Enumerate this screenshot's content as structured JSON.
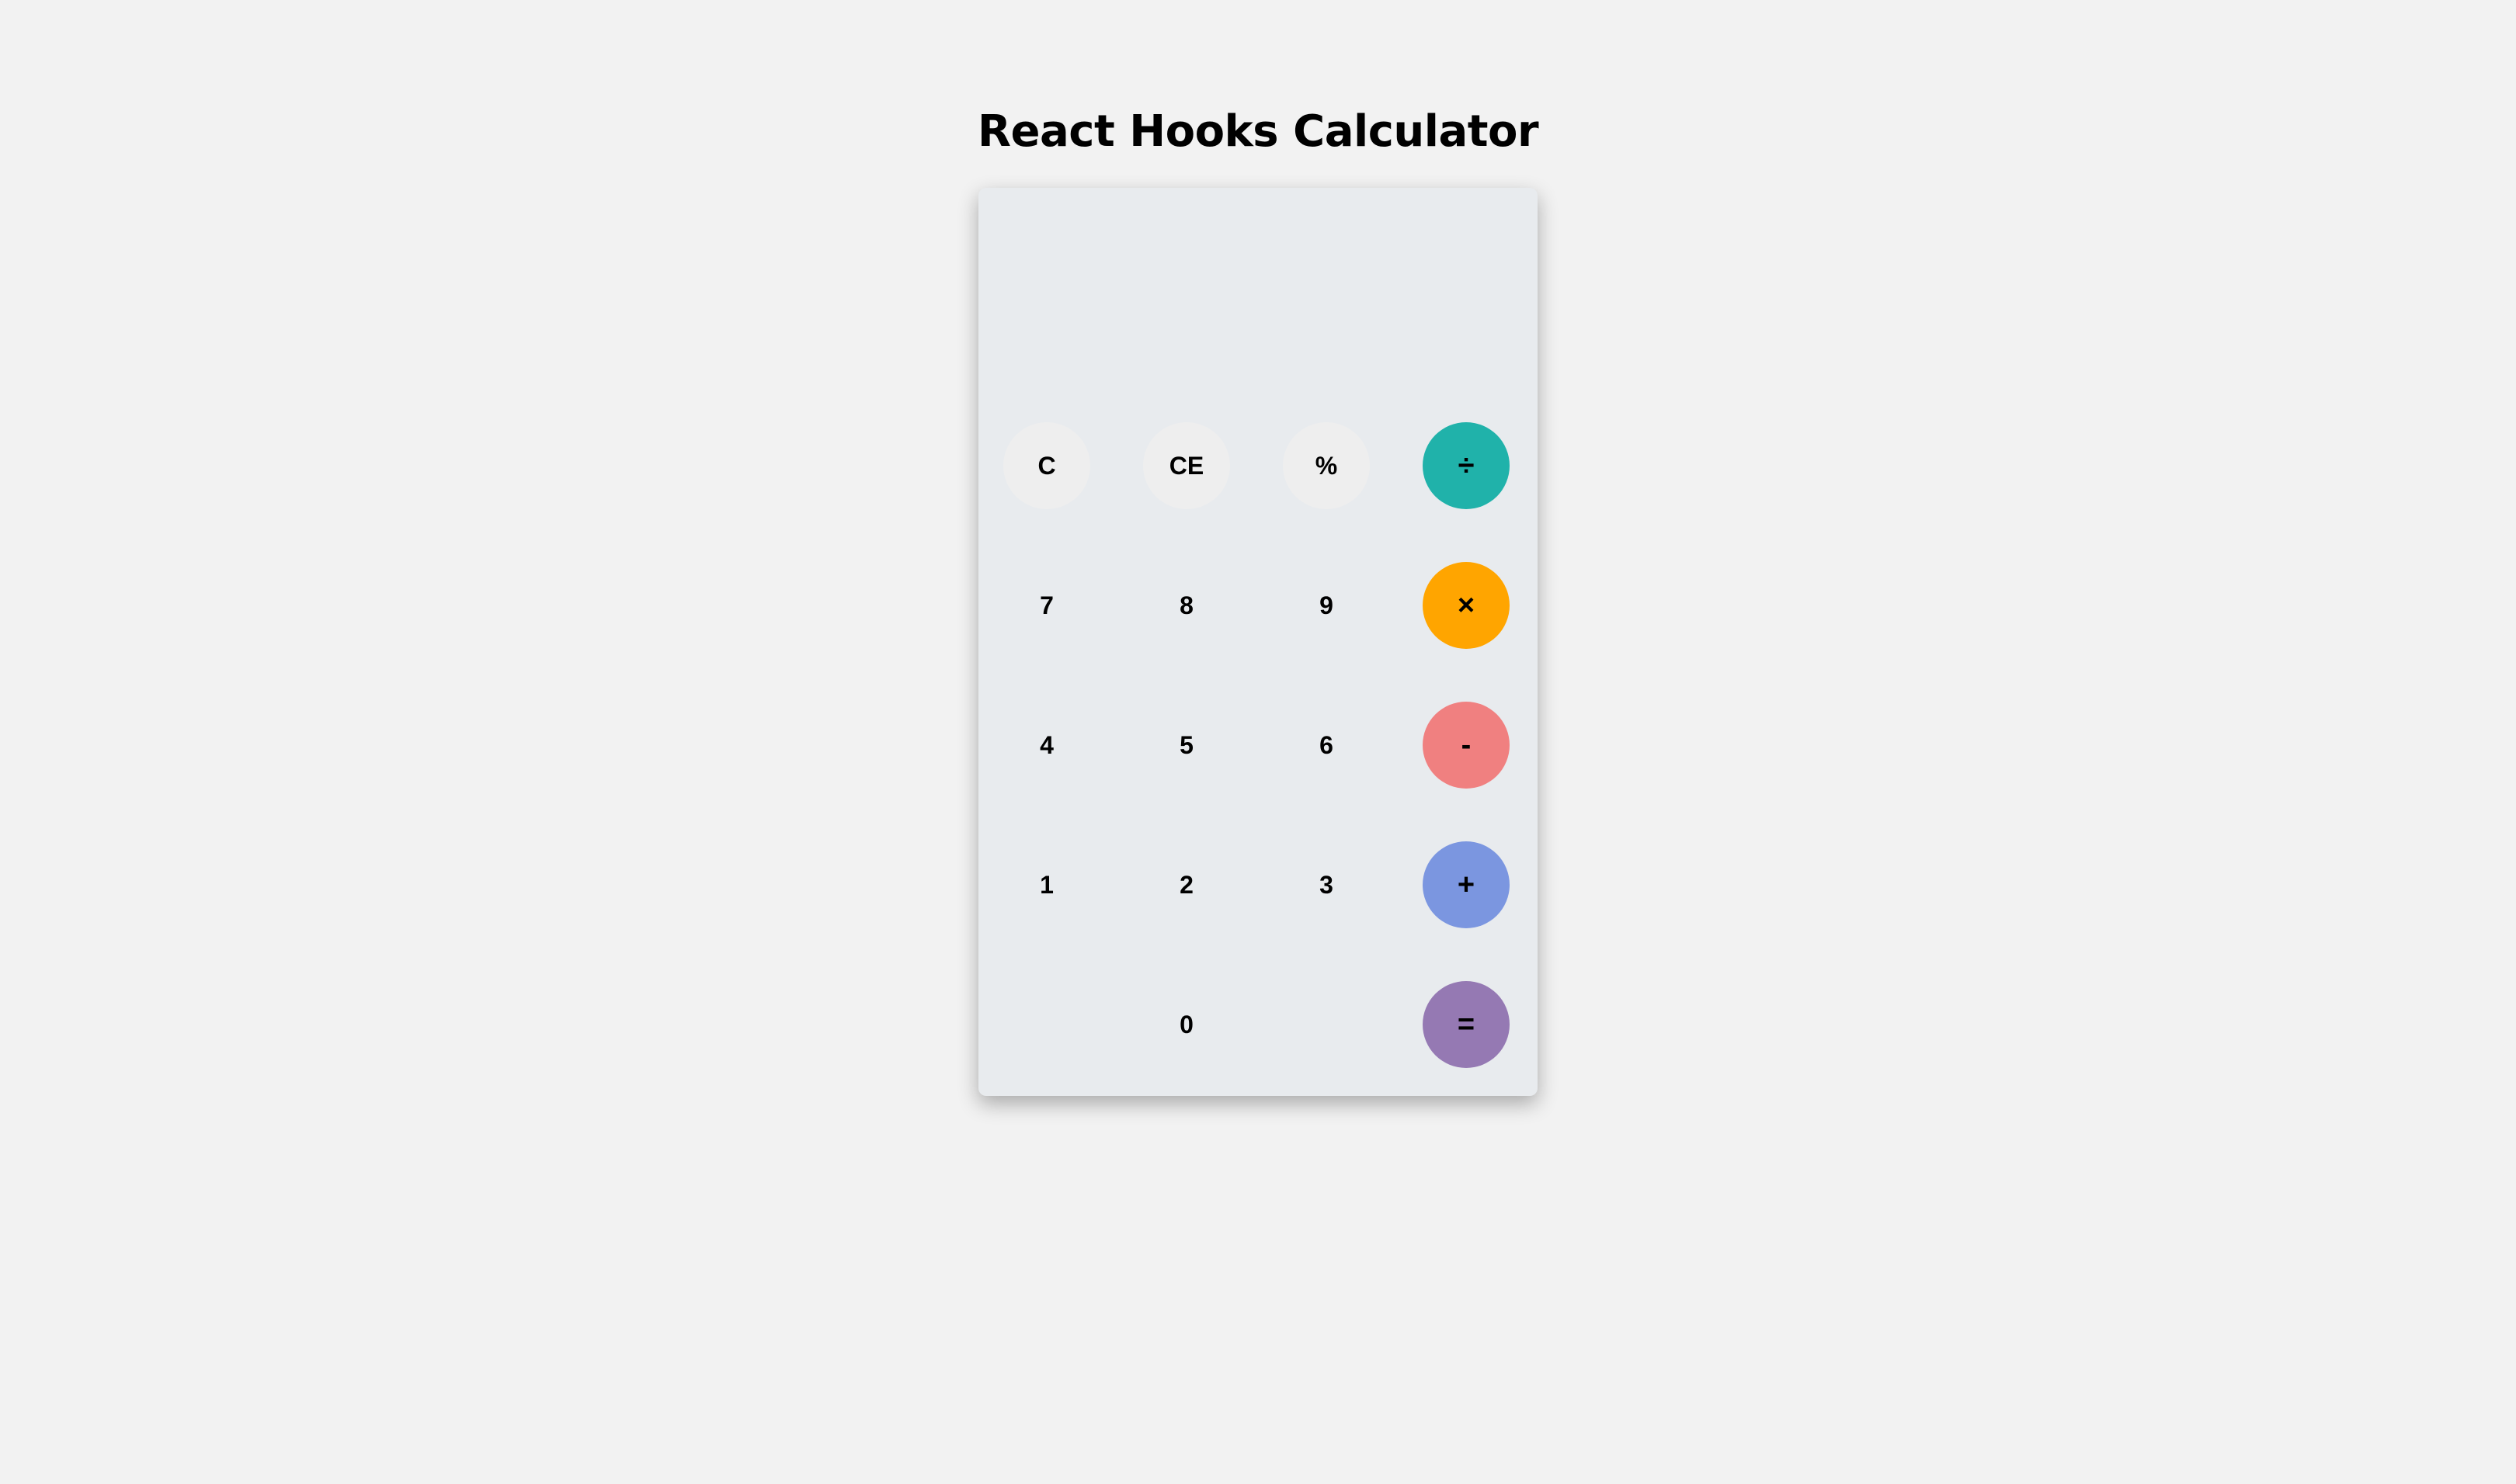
{
  "title": "React Hooks Calculator",
  "display": {
    "value": ""
  },
  "keys": [
    {
      "label": "C",
      "kind": "fn",
      "name": "clear-button"
    },
    {
      "label": "CE",
      "kind": "fn",
      "name": "clear-entry-button"
    },
    {
      "label": "%",
      "kind": "fn",
      "name": "percent-button"
    },
    {
      "label": "÷",
      "kind": "op",
      "name": "divide-button",
      "color": "#20b2aa"
    },
    {
      "label": "7",
      "kind": "num",
      "name": "digit-7-button"
    },
    {
      "label": "8",
      "kind": "num",
      "name": "digit-8-button"
    },
    {
      "label": "9",
      "kind": "num",
      "name": "digit-9-button"
    },
    {
      "label": "×",
      "kind": "op",
      "name": "multiply-button",
      "color": "#ffa500"
    },
    {
      "label": "4",
      "kind": "num",
      "name": "digit-4-button"
    },
    {
      "label": "5",
      "kind": "num",
      "name": "digit-5-button"
    },
    {
      "label": "6",
      "kind": "num",
      "name": "digit-6-button"
    },
    {
      "label": "-",
      "kind": "op",
      "name": "subtract-button",
      "color": "#f08080"
    },
    {
      "label": "1",
      "kind": "num",
      "name": "digit-1-button"
    },
    {
      "label": "2",
      "kind": "num",
      "name": "digit-2-button"
    },
    {
      "label": "3",
      "kind": "num",
      "name": "digit-3-button"
    },
    {
      "label": "+",
      "kind": "op",
      "name": "add-button",
      "color": "#7b96e0"
    },
    {
      "label": "",
      "kind": "blank",
      "name": "empty-key-slot"
    },
    {
      "label": "0",
      "kind": "num",
      "name": "digit-0-button"
    },
    {
      "label": "",
      "kind": "blank",
      "name": "empty-key-slot"
    },
    {
      "label": "=",
      "kind": "op",
      "name": "equals-button",
      "color": "#9579b3"
    }
  ],
  "colors": {
    "page_background": "#f2f2f2",
    "calculator_background": "#e8ebee",
    "function_key_background": "#eeeeee"
  }
}
